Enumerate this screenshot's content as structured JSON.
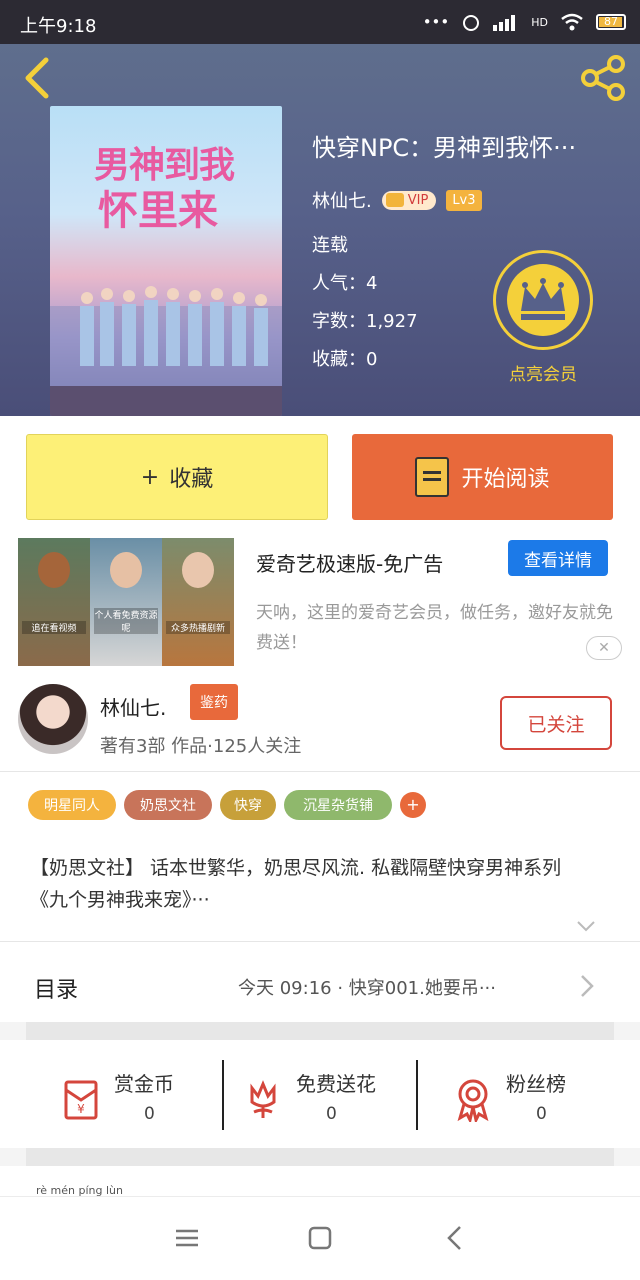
{
  "status_bar": {
    "time": "上午9:18",
    "network": "HD",
    "battery": "87",
    "battery_level": 0.87
  },
  "book": {
    "title": "快穿NPC：男神到我怀···",
    "cover_title_line1": "男神到我",
    "cover_title_line2": "怀里来",
    "author": "林仙七.",
    "vip_label": "VIP",
    "level": "Lv3",
    "status": "连载",
    "popularity": "人气：4",
    "word_count": "字数：1,927",
    "favorites": "收藏：0"
  },
  "vip_cta": {
    "label": "点亮会员"
  },
  "actions": {
    "collect_label": "收藏",
    "read_label": "开始阅读"
  },
  "ad": {
    "title": "爱奇艺极速版-免广告",
    "detail_button": "查看详情",
    "description": "天呐，这里的爱奇艺会员，做任务，邀好友就免费送！",
    "close": "✕",
    "thumb_captions": [
      "追在看视频",
      "个人看免费资源呢",
      "众多热播剧新"
    ]
  },
  "author_card": {
    "name": "林仙七.",
    "badge": "鉴药",
    "stats": "著有3部 作品·125人关注",
    "follow_button": "已关注"
  },
  "tags": [
    "明星同人",
    "奶思文社",
    "快穿",
    "沉星杂货铺"
  ],
  "tag_add": "+",
  "intro": "【奶思文社】 话本世繁华，奶思尽风流. 私戳隔壁快穿男神系列《九个男神我来宠》···",
  "catalog": {
    "label": "目录",
    "latest": "今天 09:16 · 快穿001.她要吊···"
  },
  "rewards": [
    {
      "label": "赏金币",
      "count": "0",
      "icon": "red-envelope-icon"
    },
    {
      "label": "免费送花",
      "count": "0",
      "icon": "flower-icon"
    },
    {
      "label": "粉丝榜",
      "count": "0",
      "icon": "medal-icon"
    }
  ],
  "comments_peek": {
    "label": "rè mén píng lùn"
  },
  "colors": {
    "accent_orange": "#e8693b",
    "collect_yellow": "#fdf077",
    "vip_gold": "#f4d03a",
    "ad_blue": "#1c7ae8",
    "follow_red": "#d4463c"
  }
}
